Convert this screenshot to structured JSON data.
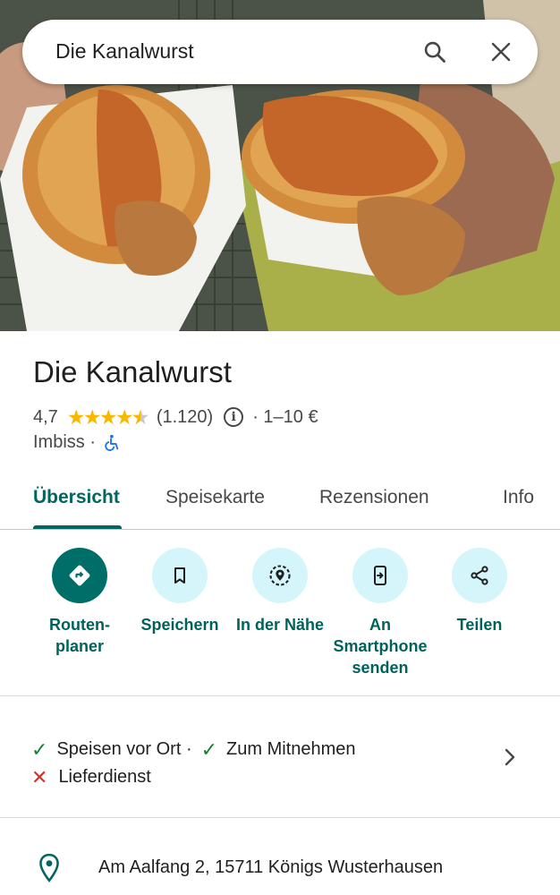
{
  "search": {
    "query": "Die Kanalwurst"
  },
  "place": {
    "name": "Die Kanalwurst",
    "rating": "4,7",
    "stars": 4.7,
    "review_count": "(1.120)",
    "price": "· 1–10 €",
    "category": "Imbiss ·"
  },
  "tabs": [
    {
      "label": "Übersicht",
      "active": true
    },
    {
      "label": "Speisekarte"
    },
    {
      "label": "Rezensionen"
    },
    {
      "label": "Info"
    }
  ],
  "actions": [
    {
      "label": "Routen-\nplaner",
      "icon": "directions-icon"
    },
    {
      "label": "Speichern",
      "icon": "bookmark-icon"
    },
    {
      "label": "In der Nähe",
      "icon": "nearby-icon"
    },
    {
      "label": "An\nSmartphone\nsenden",
      "icon": "send-to-phone-icon"
    },
    {
      "label": "Teilen",
      "icon": "share-icon"
    }
  ],
  "features": {
    "dine_in": "Speisen vor Ort ·",
    "takeaway": "Zum Mitnehmen",
    "delivery": "Lieferdienst"
  },
  "address": "Am Aalfang 2, 15711 Königs Wusterhausen",
  "colors": {
    "accent": "#00665f",
    "star": "#f9b700",
    "check": "#188038",
    "cross": "#d93025",
    "action_bg": "#d4f6fb"
  }
}
